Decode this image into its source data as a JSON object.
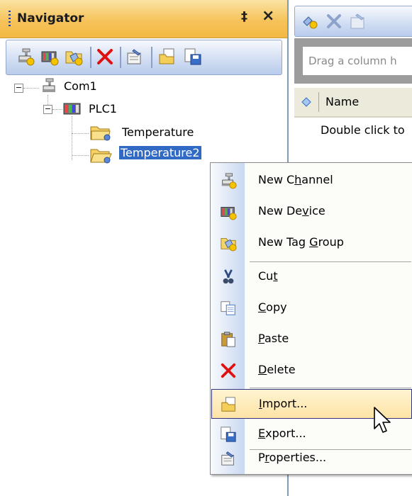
{
  "navigator": {
    "title": "Navigator",
    "pin": "‡",
    "close": "×",
    "toolbar_icons": [
      "new-channel-icon",
      "new-device-icon",
      "new-tag-group-icon",
      "delete-icon",
      "properties-icon",
      "import-icon",
      "export-icon"
    ]
  },
  "tree": {
    "channel": {
      "label": "Com1",
      "expander": "−"
    },
    "device": {
      "label": "PLC1",
      "expander": "−"
    },
    "groups": [
      {
        "label": "Temperature",
        "selected": false
      },
      {
        "label": "Temperature2",
        "selected": true
      }
    ]
  },
  "right_panel": {
    "group_hint": "Drag a column h",
    "column_name": "Name",
    "empty_hint": "Double click to"
  },
  "context_menu": {
    "items": [
      {
        "pre": "New C",
        "acc": "h",
        "post": "annel",
        "icon": "new-channel-icon"
      },
      {
        "pre": "New De",
        "acc": "v",
        "post": "ice",
        "icon": "new-device-icon"
      },
      {
        "pre": "New Tag ",
        "acc": "G",
        "post": "roup",
        "icon": "new-tag-group-icon"
      },
      {
        "pre": "Cu",
        "acc": "t",
        "post": "",
        "icon": "cut-icon"
      },
      {
        "pre": "",
        "acc": "C",
        "post": "opy",
        "icon": "copy-icon"
      },
      {
        "pre": "",
        "acc": "P",
        "post": "aste",
        "icon": "paste-icon"
      },
      {
        "pre": "",
        "acc": "D",
        "post": "elete",
        "icon": "delete-icon"
      },
      {
        "pre": "",
        "acc": "I",
        "post": "mport...",
        "icon": "import-icon"
      },
      {
        "pre": "",
        "acc": "E",
        "post": "xport...",
        "icon": "export-icon"
      },
      {
        "pre": "P",
        "acc": "r",
        "post": "operties...",
        "icon": "properties-icon"
      }
    ],
    "highlighted": "Import..."
  },
  "colors": {
    "title_bar": "#f6c35a",
    "selection": "#316ac5",
    "menu_highlight": "#fde3a6",
    "delete_red": "#e01010"
  }
}
